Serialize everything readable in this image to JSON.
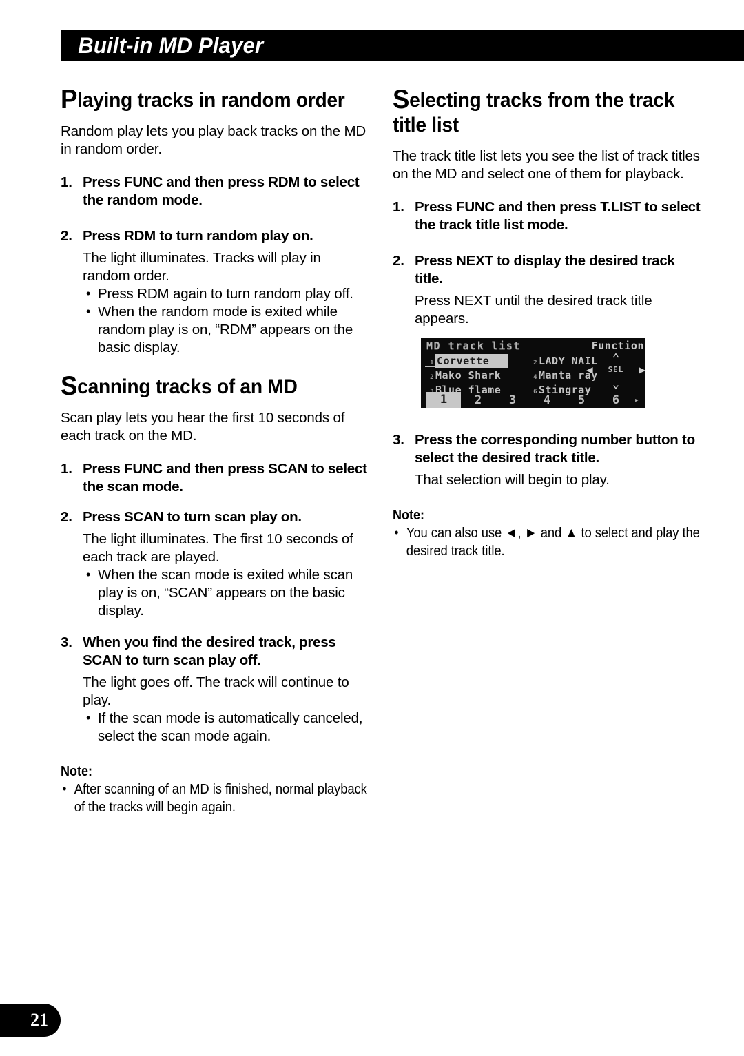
{
  "header": {
    "title": "Built-in MD Player"
  },
  "left_column": {
    "section1": {
      "heading_cap": "P",
      "heading_rest": "laying tracks in random order",
      "intro": "Random play lets you play back tracks on the MD in random order.",
      "steps": [
        {
          "num": "1.",
          "title": "Press FUNC and then press RDM to select the random mode."
        },
        {
          "num": "2.",
          "title": "Press RDM to turn random play on.",
          "body": "The light illuminates. Tracks will play in random order.",
          "bullets": [
            "Press RDM again to turn random play off.",
            "When the random mode is exited while random play is on, “RDM” appears on the basic display."
          ]
        }
      ]
    },
    "section2": {
      "heading_cap": "S",
      "heading_rest": "canning tracks of an MD",
      "intro": "Scan play lets you hear the first 10 seconds of each track on the MD.",
      "steps": [
        {
          "num": "1.",
          "title": "Press FUNC and then press SCAN to select the scan mode."
        },
        {
          "num": "2.",
          "title": "Press SCAN to turn scan play on.",
          "body": "The light illuminates. The first 10 seconds of each track are played.",
          "bullets": [
            "When the scan mode is exited while scan play is on, “SCAN” appears on the basic display."
          ]
        },
        {
          "num": "3.",
          "title": "When you find the desired track, press SCAN to turn scan play off.",
          "body": "The light goes off. The track will continue to play.",
          "bullets": [
            "If the scan mode is automatically canceled, select the scan mode again."
          ]
        }
      ],
      "note": {
        "label": "Note:",
        "items": [
          "After scanning of an MD is finished, normal playback of the tracks will begin again."
        ]
      }
    }
  },
  "right_column": {
    "section1": {
      "heading_cap": "S",
      "heading_rest": "electing tracks from the track title list",
      "intro": "The track title list lets you see the list of track titles on the MD and select one of them for playback.",
      "steps": [
        {
          "num": "1.",
          "title": "Press FUNC and then press T.LIST to select the track title list mode."
        },
        {
          "num": "2.",
          "title": "Press NEXT to display the desired track title.",
          "body": "Press NEXT until the desired track title appears."
        },
        {
          "num": "3.",
          "title": "Press the corresponding number button to select the desired track title.",
          "body": "That selection will begin to play."
        }
      ],
      "note": {
        "label": "Note:",
        "items": [
          "You can also use ◄, ► and ▲ to select and play the desired track title."
        ]
      }
    }
  },
  "lcd_display": {
    "title": "MD track list",
    "function_label": "Function",
    "tracks_left": [
      {
        "num": "1",
        "label": "Corvette",
        "selected": true
      },
      {
        "num": "2",
        "label": "Mako Shark",
        "selected": false
      },
      {
        "num": "3",
        "label": "Blue flame",
        "selected": false
      }
    ],
    "tracks_right": [
      {
        "num": "2",
        "label": "LADY NAIL",
        "selected": false
      },
      {
        "num": "4",
        "label": "Manta ray",
        "selected": false
      },
      {
        "num": "6",
        "label": "Stingray",
        "selected": false
      }
    ],
    "pad": {
      "up": "⌃",
      "left": "◀",
      "select": "SEL",
      "right": "▶",
      "down": "⌄"
    },
    "numbers": [
      "1",
      "2",
      "3",
      "4",
      "5",
      "6"
    ],
    "more_indicator": "▸"
  },
  "footer": {
    "page_number": "21"
  },
  "colors": {
    "banner": "#000000",
    "text": "#000000",
    "lcd_background": "#111111",
    "lcd_text": "#c2c2c2",
    "lcd_highlight": "#c7c7c7"
  }
}
